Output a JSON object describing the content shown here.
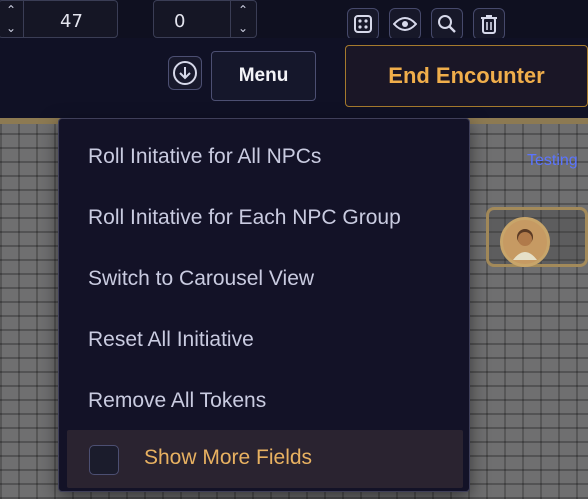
{
  "top": {
    "initiative_value": "47",
    "modifier_value": "0",
    "tool_icons": [
      "dice-icon",
      "eye-icon",
      "search-icon",
      "trash-icon"
    ]
  },
  "header": {
    "menu_label": "Menu",
    "end_label": "End Encounter"
  },
  "map": {
    "label": "Testing"
  },
  "dropdown": {
    "items": [
      "Roll Initative for All NPCs",
      "Roll Initative for Each NPC Group",
      "Switch to Carousel View",
      "Reset All Initiative",
      "Remove All Tokens"
    ],
    "checkbox_label": "Show More Fields"
  },
  "colors": {
    "accent_gold": "#f0ae4b",
    "map_label_blue": "#5a74ff"
  }
}
